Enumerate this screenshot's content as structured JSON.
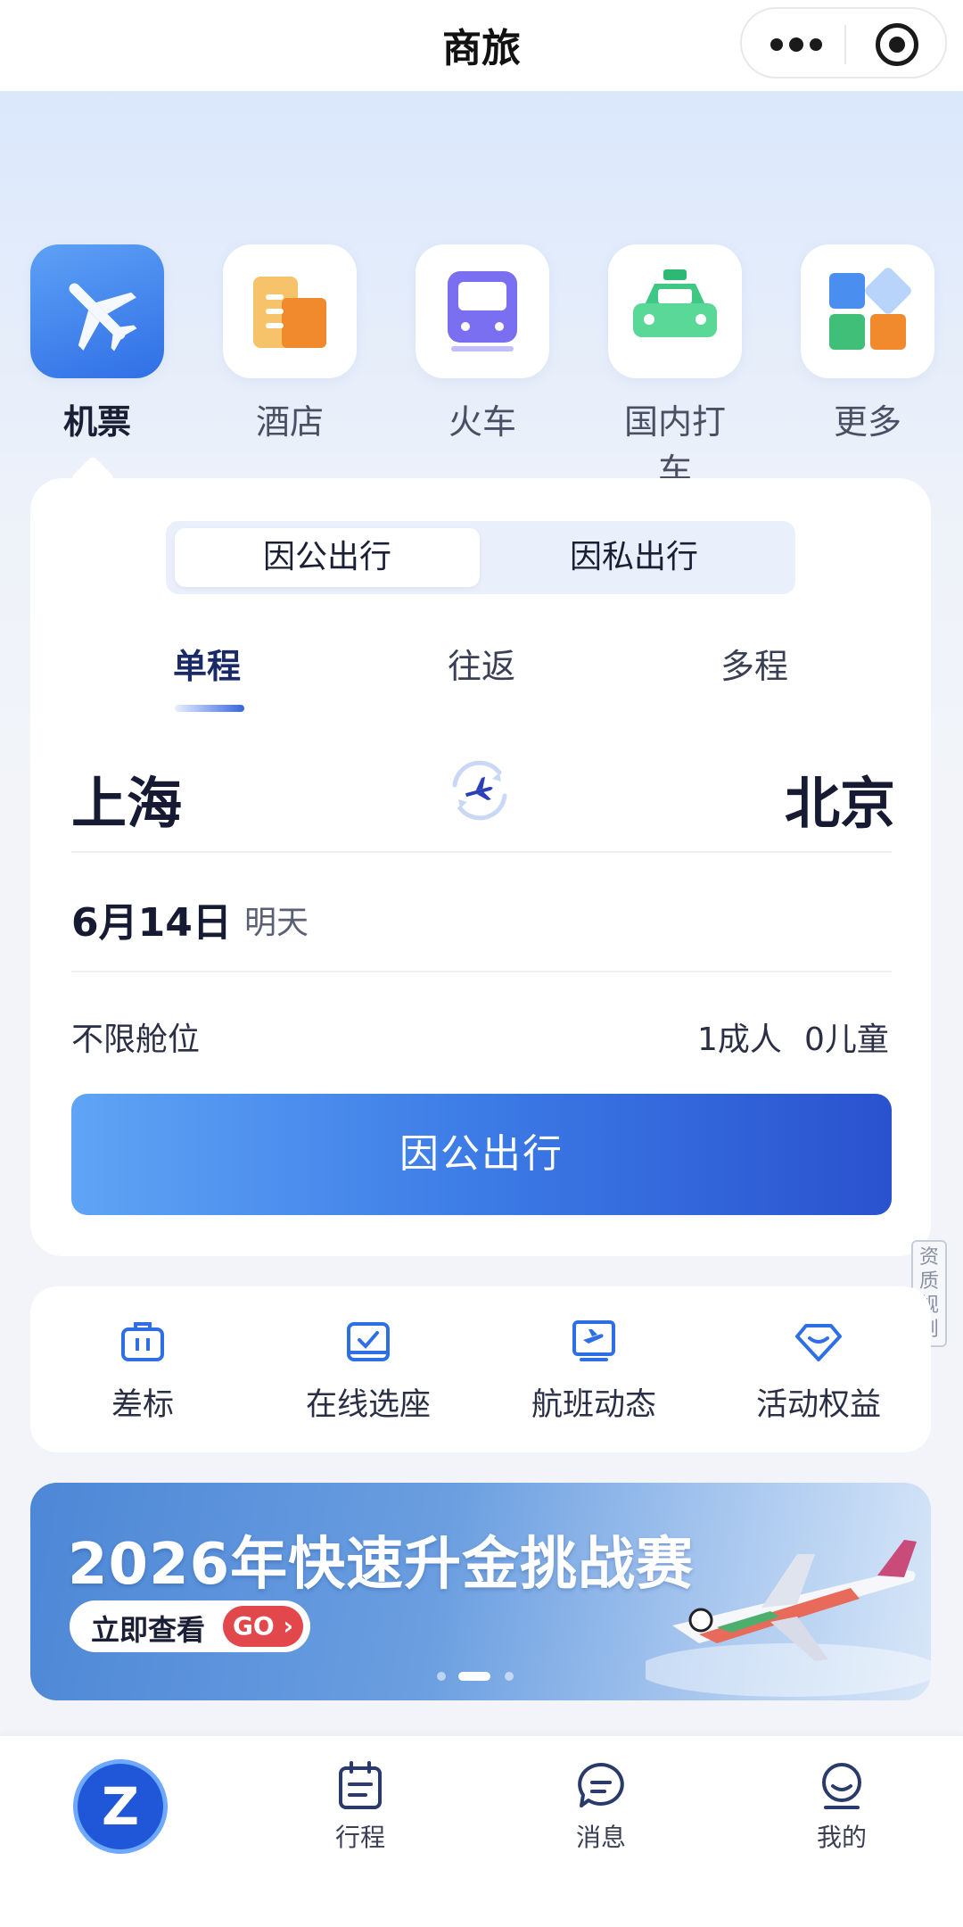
{
  "header": {
    "title": "商旅"
  },
  "categories": [
    {
      "label": "机票",
      "icon": "airplane-icon"
    },
    {
      "label": "酒店",
      "icon": "hotel-icon"
    },
    {
      "label": "火车",
      "icon": "train-icon"
    },
    {
      "label": "国内打车",
      "icon": "taxi-icon"
    },
    {
      "label": "更多",
      "icon": "more-apps-icon"
    }
  ],
  "booking": {
    "segments": [
      "因公出行",
      "因私出行"
    ],
    "trip_types": [
      "单程",
      "往返",
      "多程"
    ],
    "from_city": "上海",
    "to_city": "北京",
    "date": "6月14日",
    "date_hint": "明天",
    "cabin": "不限舱位",
    "adults": "1成人",
    "children": "0儿童",
    "cta": "因公出行"
  },
  "side_tag": "资质规则",
  "services": [
    {
      "label": "差标",
      "icon": "briefcase-icon"
    },
    {
      "label": "在线选座",
      "icon": "seat-select-icon"
    },
    {
      "label": "航班动态",
      "icon": "flight-status-icon"
    },
    {
      "label": "活动权益",
      "icon": "diamond-icon"
    }
  ],
  "banner": {
    "title": "2026年快速升金挑战赛",
    "button": "立即查看",
    "go": "GO"
  },
  "bottom_nav": [
    {
      "label": "",
      "icon": "home-logo-icon"
    },
    {
      "label": "行程",
      "icon": "itinerary-icon"
    },
    {
      "label": "消息",
      "icon": "message-icon"
    },
    {
      "label": "我的",
      "icon": "profile-icon"
    }
  ],
  "colors": {
    "accent": "#2f6fe6",
    "cta_start": "#5fa4f5",
    "cta_end": "#2a52cf",
    "go_red": "#e2474b"
  }
}
